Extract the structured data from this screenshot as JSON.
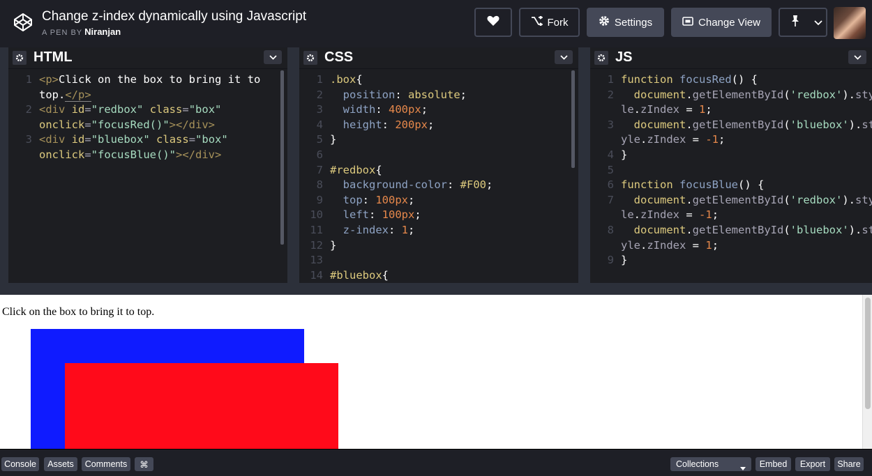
{
  "header": {
    "title": "Change z-index dynamically using Javascript",
    "byline_prefix": "A PEN BY",
    "author": "Niranjan",
    "fork_label": "Fork",
    "settings_label": "Settings",
    "change_view_label": "Change View"
  },
  "panels": {
    "html": {
      "title": "HTML",
      "line_numbers": [
        "1",
        "2",
        "3"
      ]
    },
    "css": {
      "title": "CSS",
      "line_numbers": [
        "1",
        "2",
        "3",
        "4",
        "5",
        "6",
        "7",
        "8",
        "9",
        "10",
        "11",
        "12",
        "13",
        "14"
      ]
    },
    "js": {
      "title": "JS",
      "line_numbers": [
        "1",
        "2",
        "3",
        "4",
        "5",
        "6",
        "7",
        "8",
        "9"
      ]
    }
  },
  "code": {
    "html": {
      "l1a": "<p>",
      "l1b": "Click on the box to bring it to",
      "l1c": "top.",
      "l1d": "</p>",
      "l2a": "<div",
      "l2b": "id",
      "l2c": "=",
      "l2d": "\"redbox\"",
      "l2e": "class",
      "l2f": "=",
      "l2g": "\"box\"",
      "l2h": "onclick",
      "l2i": "=",
      "l2j": "\"focusRed()\"",
      "l2k": "></div>",
      "l3a": "<div",
      "l3b": "id",
      "l3c": "=",
      "l3d": "\"bluebox\"",
      "l3e": "class",
      "l3f": "=",
      "l3g": "\"box\"",
      "l3h": "onclick",
      "l3i": "=",
      "l3j": "\"focusBlue()\"",
      "l3k": "></div>"
    },
    "css": {
      "box_sel": ".box",
      "brace_open": "{",
      "brace_close": "}",
      "position_prop": "position",
      "position_val": "absolute",
      "width_prop": "width",
      "width_val": "400px",
      "height_prop": "height",
      "height_val": "200px",
      "redbox_sel": "#redbox",
      "bg_prop": "background-color",
      "bg_val": "#F00",
      "top_prop": "top",
      "top_val": "100px",
      "left_prop": "left",
      "left_val": "100px",
      "z_prop": "z-index",
      "z_val": "1",
      "bluebox_sel": "#bluebox"
    },
    "js": {
      "kw": "function",
      "fn1": "focusRed",
      "fn2": "focusBlue",
      "parens": "()",
      "open": " {",
      "close": "}",
      "doc": "document",
      "dot": ".",
      "get": "getElementById",
      "lp": "(",
      "rp": ")",
      "red": "'redbox'",
      "blue": "'bluebox'",
      "sty": "sty",
      "le": "le",
      "st": "st",
      "yle": "yle",
      "zi": "zIndex",
      "eq": " = ",
      "one": "1",
      "neg": "-1",
      "semi": ";"
    }
  },
  "preview": {
    "text": "Click on the box to bring it to top.",
    "red": "#FF0000",
    "blue": "#0000FF"
  },
  "footer": {
    "console": "Console",
    "assets": "Assets",
    "comments": "Comments",
    "shortcut": "⌘",
    "collections": "Collections",
    "embed": "Embed",
    "export": "Export",
    "share": "Share"
  },
  "colors": {
    "bar": "#1e1f26",
    "button": "#444857",
    "editor": "#1d1e22"
  }
}
